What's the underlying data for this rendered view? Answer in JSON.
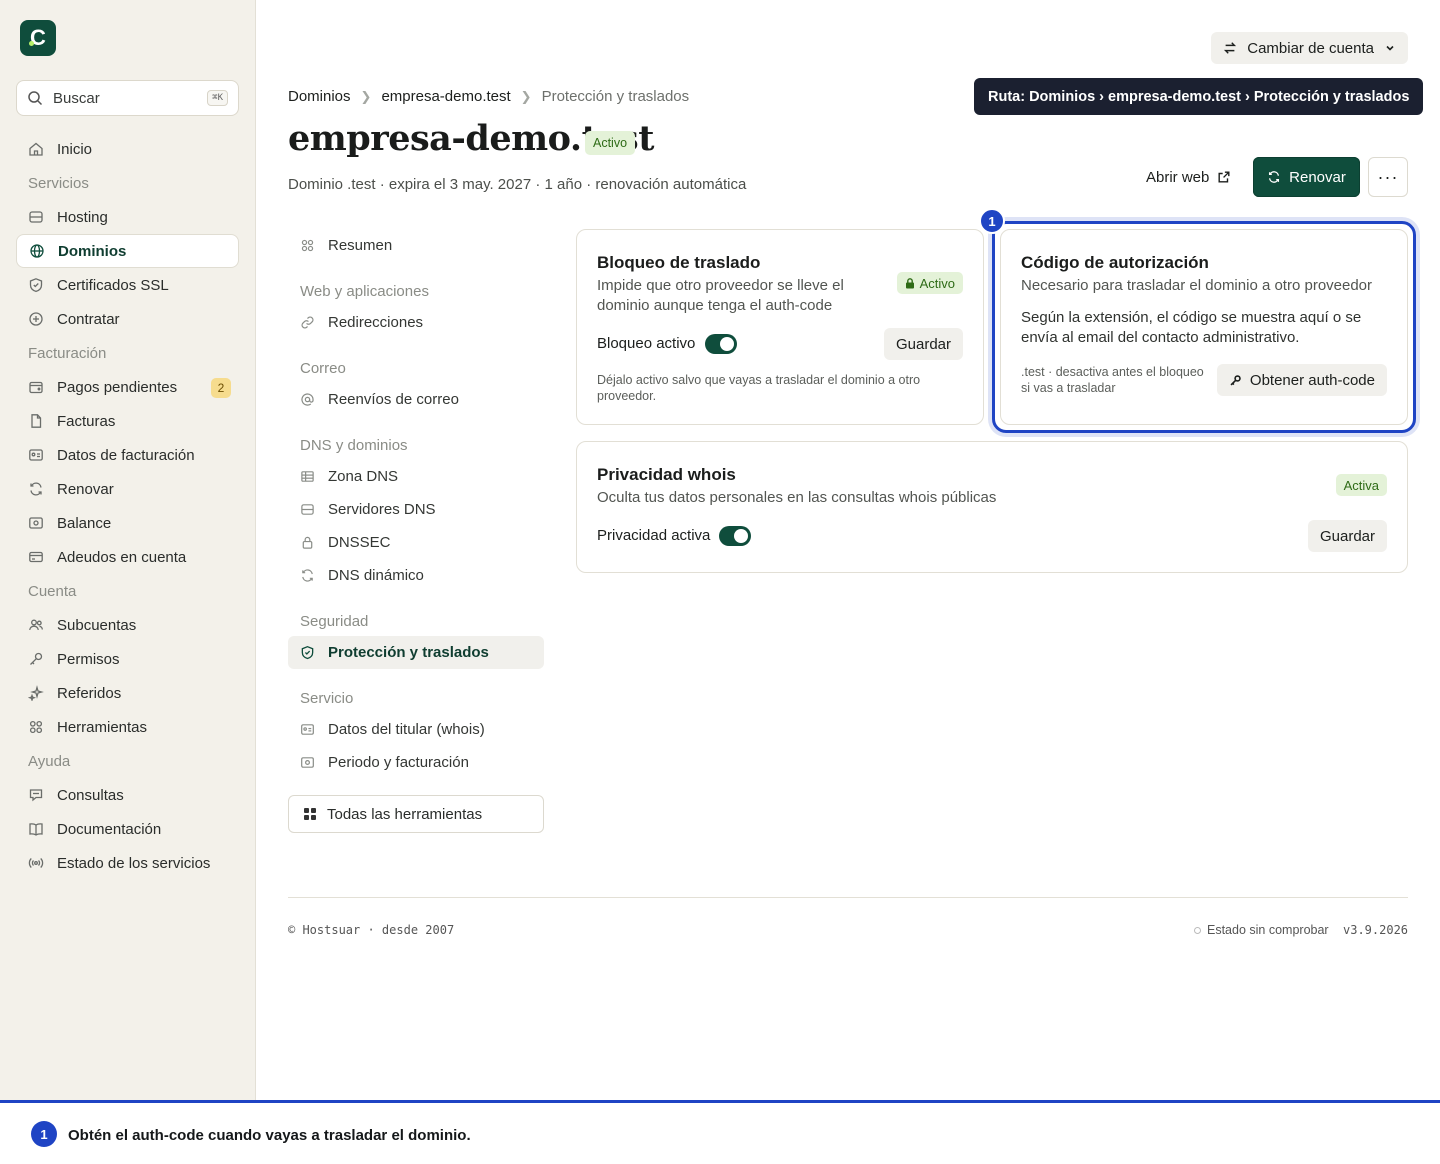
{
  "sidebar": {
    "logo_letter": "C",
    "search": {
      "placeholder": "Buscar",
      "shortcut": "⌘K"
    },
    "items": [
      {
        "label": "Inicio",
        "icon": "home-icon"
      },
      {
        "group": "Servicios"
      },
      {
        "label": "Hosting",
        "icon": "server-icon"
      },
      {
        "label": "Dominios",
        "icon": "globe-icon",
        "active": true
      },
      {
        "label": "Certificados SSL",
        "icon": "shield-icon"
      },
      {
        "label": "Contratar",
        "icon": "plus-circle-icon"
      },
      {
        "group": "Facturación"
      },
      {
        "label": "Pagos pendientes",
        "icon": "wallet-icon",
        "badge": "2"
      },
      {
        "label": "Facturas",
        "icon": "file-icon"
      },
      {
        "label": "Datos de facturación",
        "icon": "id-card-icon"
      },
      {
        "label": "Renovar",
        "icon": "refresh-icon"
      },
      {
        "label": "Balance",
        "icon": "banknote-icon"
      },
      {
        "label": "Adeudos en cuenta",
        "icon": "credit-card-icon"
      },
      {
        "group": "Cuenta"
      },
      {
        "label": "Subcuentas",
        "icon": "users-icon"
      },
      {
        "label": "Permisos",
        "icon": "key-icon"
      },
      {
        "label": "Referidos",
        "icon": "sparkles-icon"
      },
      {
        "label": "Herramientas",
        "icon": "grid-icon"
      },
      {
        "group": "Ayuda"
      },
      {
        "label": "Consultas",
        "icon": "chat-icon"
      },
      {
        "label": "Documentación",
        "icon": "book-icon"
      },
      {
        "label": "Estado de los servicios",
        "icon": "broadcast-icon"
      }
    ]
  },
  "topbar": {
    "switch_account": "Cambiar de cuenta",
    "tooltip": "Ruta: Dominios › empresa-demo.test › Protección y traslados"
  },
  "breadcrumb": [
    "Dominios",
    "empresa-demo.test",
    "Protección y traslados"
  ],
  "header": {
    "title": "empresa-demo.test",
    "status": "Activo",
    "subtitle": "Dominio .test · expira el 3 may. 2027 · 1 año · renovación automática",
    "open_web": "Abrir web",
    "renew": "Renovar",
    "more": "···"
  },
  "subnav": {
    "items": [
      {
        "label": "Resumen",
        "icon": "grid-icon"
      },
      {
        "group": "Web y aplicaciones"
      },
      {
        "label": "Redirecciones",
        "icon": "link-icon"
      },
      {
        "group": "Correo"
      },
      {
        "label": "Reenvíos de correo",
        "icon": "at-icon"
      },
      {
        "group": "DNS y dominios"
      },
      {
        "label": "Zona DNS",
        "icon": "table-icon"
      },
      {
        "label": "Servidores DNS",
        "icon": "server-icon"
      },
      {
        "label": "DNSSEC",
        "icon": "lock-icon"
      },
      {
        "label": "DNS dinámico",
        "icon": "refresh-icon"
      },
      {
        "group": "Seguridad"
      },
      {
        "label": "Protección y traslados",
        "icon": "shield-icon",
        "active": true
      },
      {
        "group": "Servicio"
      },
      {
        "label": "Datos del titular (whois)",
        "icon": "id-card-icon"
      },
      {
        "label": "Periodo y facturación",
        "icon": "banknote-icon"
      }
    ],
    "all_tools": "Todas las herramientas"
  },
  "cards": {
    "lock": {
      "title": "Bloqueo de traslado",
      "desc": "Impide que otro proveedor se lleve el dominio aunque tenga el auth-code",
      "badge": "Activo",
      "toggle_label": "Bloqueo activo",
      "toggle_on": true,
      "save": "Guardar",
      "note": "Déjalo activo salvo que vayas a trasladar el dominio a otro proveedor."
    },
    "auth": {
      "title": "Código de autorización",
      "desc": "Necesario para trasladar el dominio a otro proveedor",
      "body": "Según la extensión, el código se muestra aquí o se envía al email del contacto administrativo.",
      "note": ".test · desactiva antes el bloqueo si vas a trasladar",
      "button": "Obtener auth-code"
    },
    "privacy": {
      "title": "Privacidad whois",
      "desc": "Oculta tus datos personales en las consultas whois públicas",
      "badge": "Activa",
      "toggle_label": "Privacidad activa",
      "toggle_on": true,
      "save": "Guardar"
    }
  },
  "footer": {
    "copyright": "© Hostsuar · desde 2007",
    "status": "Estado sin comprobar",
    "version": "v3.9.2026"
  },
  "annotation": {
    "number": "1",
    "text": "Obtén el auth-code cuando vayas a trasladar el dominio."
  },
  "colors": {
    "brand": "#0f4d3c",
    "highlight": "#1f44c4",
    "sidebar_bg": "#f3f1ea",
    "badge_green_bg": "#e4f2d8",
    "badge_amber_bg": "#f6dc8e"
  }
}
